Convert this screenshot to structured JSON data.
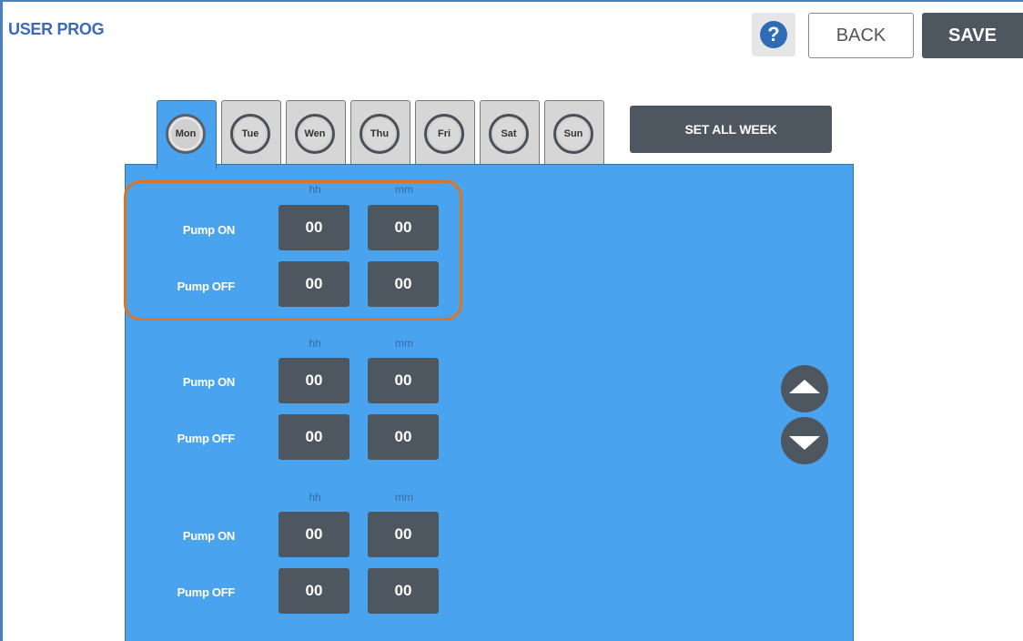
{
  "header": {
    "title": "USER PROG",
    "help_label": "?",
    "back_label": "BACK",
    "save_label": "SAVE"
  },
  "days": [
    {
      "label": "Mon",
      "active": true
    },
    {
      "label": "Tue",
      "active": false
    },
    {
      "label": "Wen",
      "active": false
    },
    {
      "label": "Thu",
      "active": false
    },
    {
      "label": "Fri",
      "active": false
    },
    {
      "label": "Sat",
      "active": false
    },
    {
      "label": "Sun",
      "active": false
    }
  ],
  "set_all_week_label": "SET ALL WEEK",
  "columns": {
    "hours": "hh",
    "minutes": "mm"
  },
  "slots": [
    {
      "on_label": "Pump ON",
      "off_label": "Pump OFF",
      "on_hh": "00",
      "on_mm": "00",
      "off_hh": "00",
      "off_mm": "00",
      "highlighted": true
    },
    {
      "on_label": "Pump ON",
      "off_label": "Pump OFF",
      "on_hh": "00",
      "on_mm": "00",
      "off_hh": "00",
      "off_mm": "00",
      "highlighted": false
    },
    {
      "on_label": "Pump ON",
      "off_label": "Pump OFF",
      "on_hh": "00",
      "on_mm": "00",
      "off_hh": "00",
      "off_mm": "00",
      "highlighted": false
    }
  ],
  "icons": {
    "help": "question-circle-icon",
    "up": "arrow-up-icon",
    "down": "arrow-down-icon"
  },
  "colors": {
    "accent": "#4aa3ee",
    "button": "#4e5760",
    "highlight": "#e0731f",
    "title": "#3d6ab8"
  }
}
